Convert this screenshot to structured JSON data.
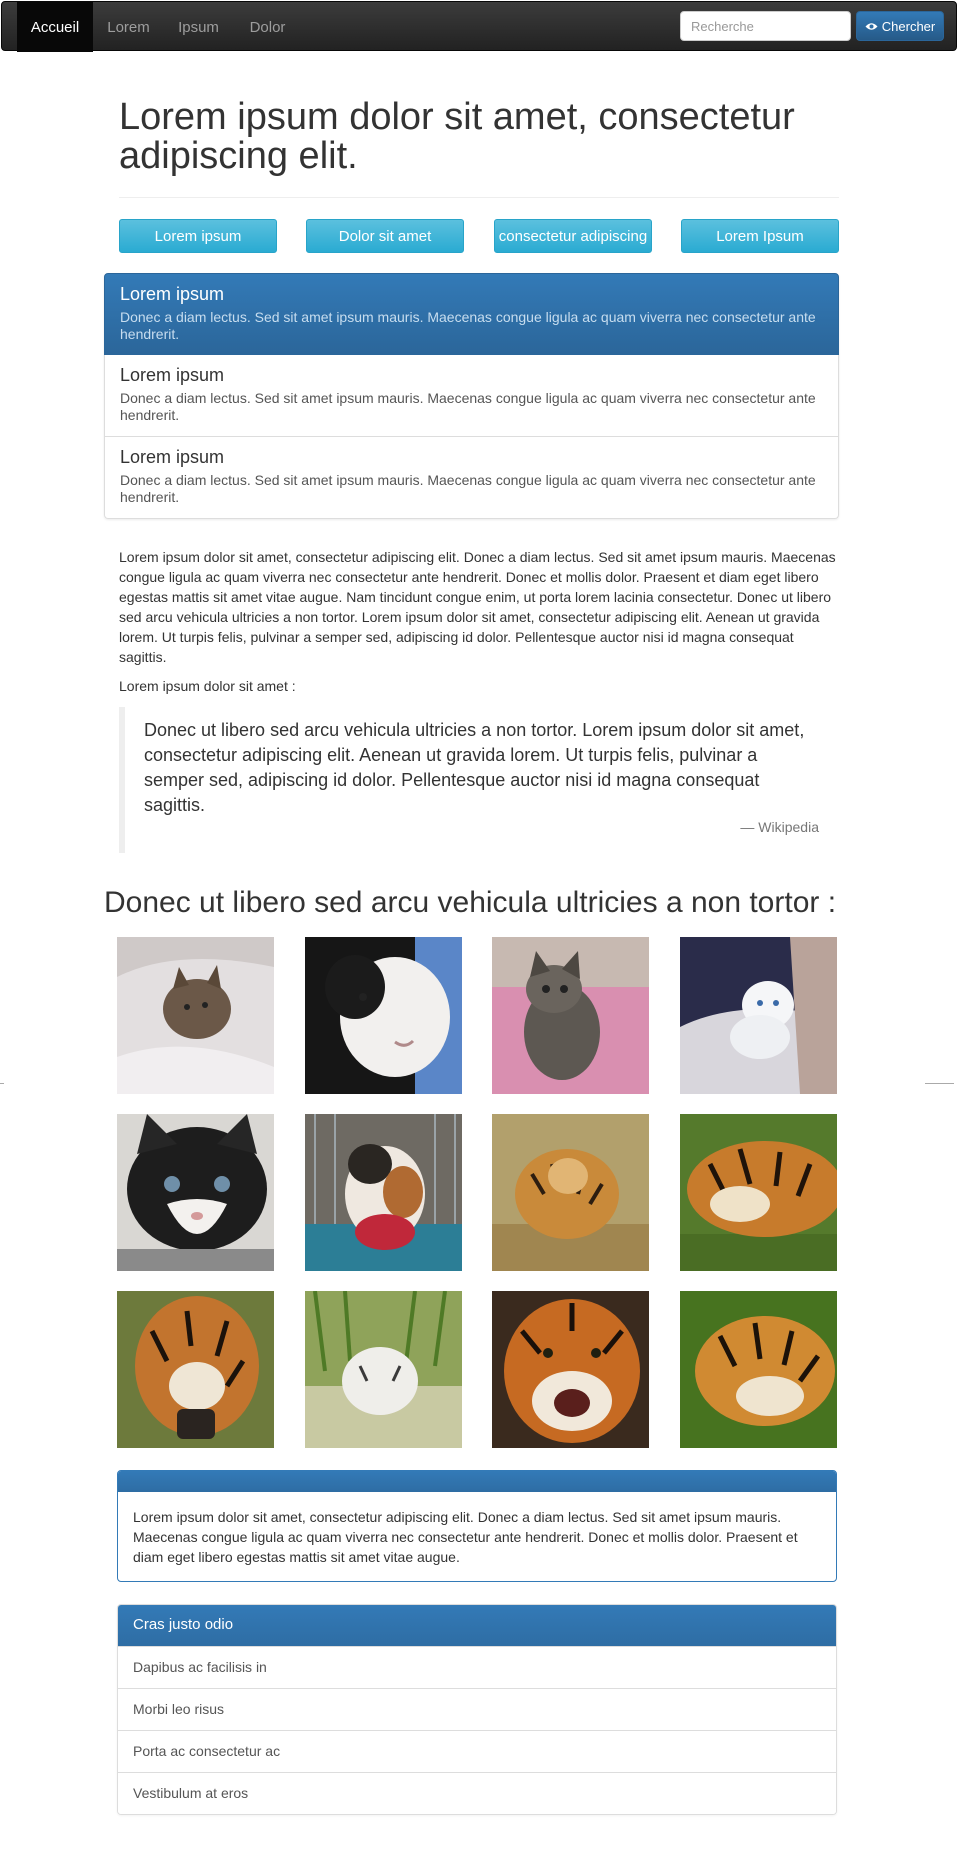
{
  "navbar": {
    "items": [
      {
        "label": "Accueil",
        "active": true
      },
      {
        "label": "Lorem"
      },
      {
        "label": "Ipsum"
      },
      {
        "label": "Dolor"
      }
    ],
    "search_placeholder": "Recherche",
    "search_button": "Chercher",
    "search_button_icon": "eye-icon"
  },
  "header": {
    "title": "Lorem ipsum dolor sit amet, consectetur adipiscing elit."
  },
  "buttons": [
    "Lorem ipsum",
    "Dolor sit amet",
    "consectetur adipiscing",
    "Lorem Ipsum"
  ],
  "list_group": [
    {
      "heading": "Lorem ipsum",
      "text": "Donec a diam lectus. Sed sit amet ipsum mauris. Maecenas congue ligula ac quam viverra nec consectetur ante hendrerit."
    },
    {
      "heading": "Lorem ipsum",
      "text": "Donec a diam lectus. Sed sit amet ipsum mauris. Maecenas congue ligula ac quam viverra nec consectetur ante hendrerit."
    },
    {
      "heading": "Lorem ipsum",
      "text": "Donec a diam lectus. Sed sit amet ipsum mauris. Maecenas congue ligula ac quam viverra nec consectetur ante hendrerit."
    }
  ],
  "paragraph": "Lorem ipsum dolor sit amet, consectetur adipiscing elit. Donec a diam lectus. Sed sit amet ipsum mauris. Maecenas congue ligula ac quam viverra nec consectetur ante hendrerit. Donec et mollis dolor. Praesent et diam eget libero egestas mattis sit amet vitae augue. Nam tincidunt congue enim, ut porta lorem lacinia consectetur. Donec ut libero sed arcu vehicula ultricies a non tortor. Lorem ipsum dolor sit amet, consectetur adipiscing elit. Aenean ut gravida lorem. Ut turpis felis, pulvinar a semper sed, adipiscing id dolor. Pellentesque auctor nisi id magna consequat sagittis.",
  "quote_intro": "Lorem ipsum dolor sit amet :",
  "blockquote": {
    "text": "Donec ut libero sed arcu vehicula ultricies a non tortor. Lorem ipsum dolor sit amet, consectetur adipiscing elit. Aenean ut gravida lorem. Ut turpis felis, pulvinar a semper sed, adipiscing id dolor. Pellentesque auctor nisi id magna consequat sagittis.",
    "source": "— Wikipedia"
  },
  "gallery_title": "Donec ut libero sed arcu vehicula ultricies a non tortor :",
  "gallery": [
    {
      "subject": "cat-in-blanket-photo"
    },
    {
      "subject": "black-white-kitten-photo"
    },
    {
      "subject": "tabby-kitten-photo"
    },
    {
      "subject": "white-kitten-photo"
    },
    {
      "subject": "black-white-kitten-closeup-photo"
    },
    {
      "subject": "calico-kitten-photo"
    },
    {
      "subject": "tiger-cub-photo"
    },
    {
      "subject": "tiger-lying-photo"
    },
    {
      "subject": "tiger-walking-photo"
    },
    {
      "subject": "white-tiger-water-photo"
    },
    {
      "subject": "tiger-roaring-photo"
    },
    {
      "subject": "tiger-resting-photo"
    }
  ],
  "panel": {
    "body": "Lorem ipsum dolor sit amet, consectetur adipiscing elit. Donec a diam lectus. Sed sit amet ipsum mauris. Maecenas congue ligula ac quam viverra nec consectetur ante hendrerit. Donec et mollis dolor. Praesent et diam eget libero egestas mattis sit amet vitae augue."
  },
  "panel_list": {
    "heading": "Cras justo odio",
    "items": [
      "Dapibus ac facilisis in",
      "Morbi leo risus",
      "Porta ac consectetur ac",
      "Vestibulum at eros"
    ]
  },
  "colors": {
    "primary": "#337ab7",
    "info": "#5bc0de",
    "navbar": "#222222"
  }
}
